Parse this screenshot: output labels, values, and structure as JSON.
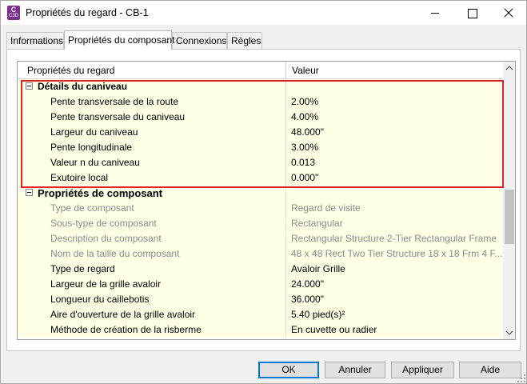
{
  "window": {
    "title": "Propriétés du regard - CB-1",
    "app_icon": {
      "letter": "C",
      "sub": "C3D",
      "color": "#7b2e8e"
    }
  },
  "tabs": [
    {
      "label": "Informations",
      "active": false
    },
    {
      "label": "Propriétés du composant",
      "active": true
    },
    {
      "label": "Connexions",
      "active": false
    },
    {
      "label": "Règles",
      "active": false
    }
  ],
  "grid": {
    "headers": {
      "property": "Propriétés du regard",
      "value": "Valeur"
    },
    "group1": {
      "label": "Détails du caniveau",
      "rows": [
        {
          "name": "Pente transversale de la route",
          "value": "2.00%"
        },
        {
          "name": "Pente transversale du caniveau",
          "value": "4.00%"
        },
        {
          "name": "Largeur du caniveau",
          "value": "48.000\""
        },
        {
          "name": "Pente longitudinale",
          "value": "3.00%"
        },
        {
          "name": "Valeur n du caniveau",
          "value": "0.013"
        },
        {
          "name": "Exutoire local",
          "value": "0.000\""
        }
      ]
    },
    "group2": {
      "label": "Propriétés de composant",
      "rows": [
        {
          "name": "Type de composant",
          "value": "Regard de visite",
          "disabled": true
        },
        {
          "name": "Sous-type de composant",
          "value": "Rectangular",
          "disabled": true
        },
        {
          "name": "Description du composant",
          "value": "Rectangular Structure 2-Tier Rectangular Frame",
          "disabled": true
        },
        {
          "name": "Nom de la taille du composant",
          "value": "48 x 48 Rect Two Tier Structure 18 x 18 Frm 4 F...",
          "disabled": true
        },
        {
          "name": "Type de regard",
          "value": "Avaloir Grille",
          "disabled": false
        },
        {
          "name": "Largeur de la grille avaloir",
          "value": "24.000\"",
          "disabled": false
        },
        {
          "name": "Longueur du caillebotis",
          "value": "36.000\"",
          "disabled": false
        },
        {
          "name": "Aire d'ouverture de la grille avaloir",
          "value": "5.40 pied(s)²",
          "disabled": false
        },
        {
          "name": "Méthode de création de la risberme",
          "value": "En cuvette ou radier",
          "disabled": false
        }
      ]
    }
  },
  "buttons": {
    "ok": "OK",
    "cancel": "Annuler",
    "apply": "Appliquer",
    "help": "Aide"
  },
  "colors": {
    "highlight": "#d9262b",
    "row_bg": "#ffffe6",
    "ok_border": "#0078d7"
  }
}
